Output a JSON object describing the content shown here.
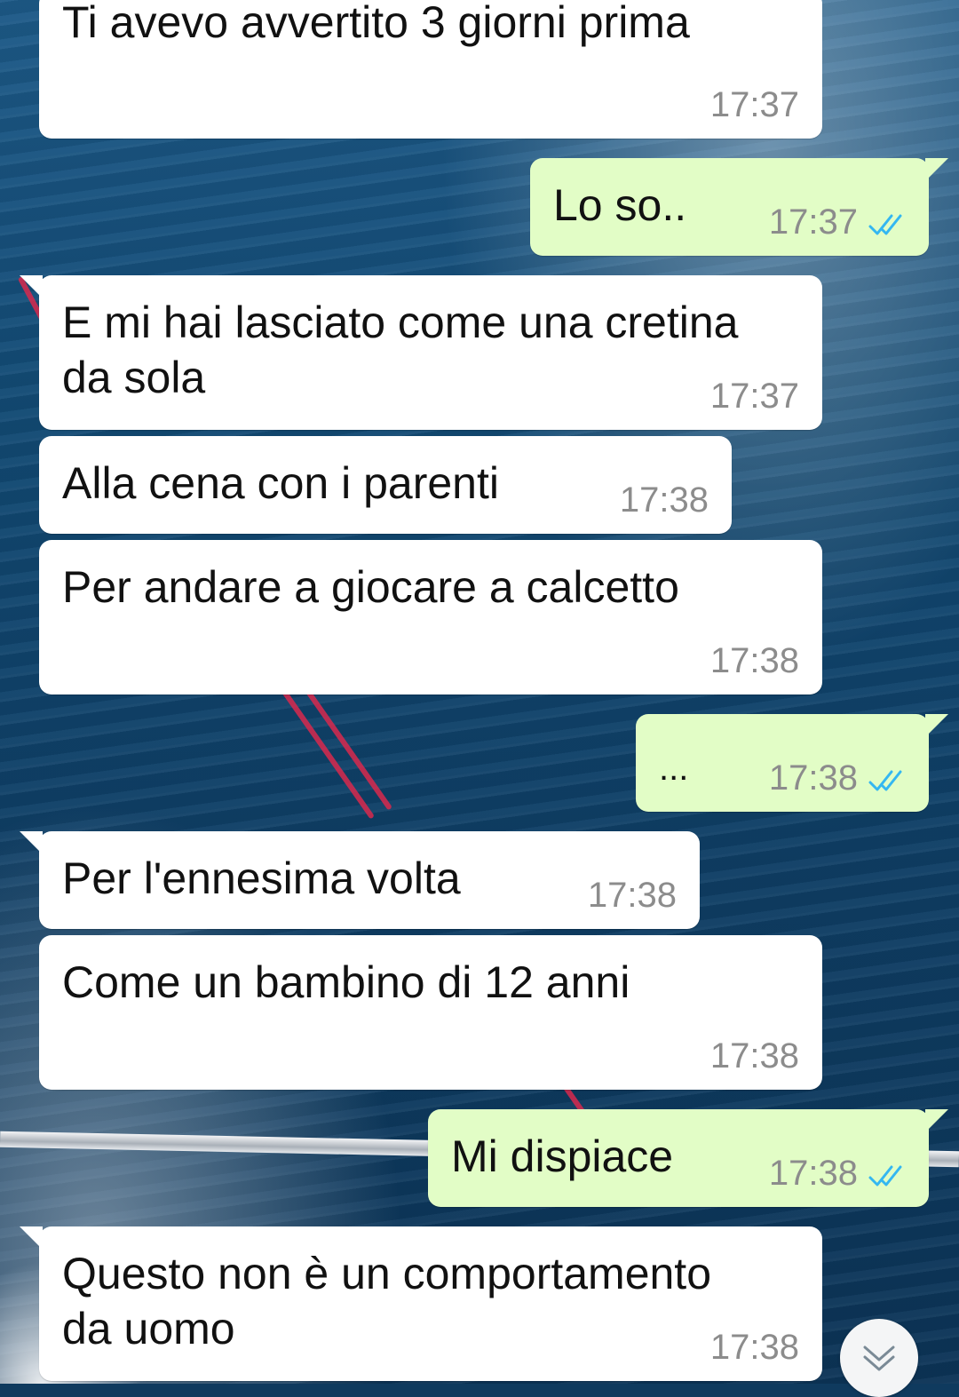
{
  "colors": {
    "incoming_bubble": "#ffffff",
    "outgoing_bubble": "#e2fdc6",
    "timestamp": "#8c8c8c",
    "read_ticks": "#34b7f1"
  },
  "messages": [
    {
      "direction": "incoming",
      "text": "Ti avevo avvertito 3 giorni prima",
      "time": "17:37"
    },
    {
      "direction": "outgoing",
      "text": "Lo so..",
      "time": "17:37",
      "status": "read"
    },
    {
      "direction": "incoming",
      "text": "E mi hai lasciato come una cretina\nda sola",
      "time": "17:37"
    },
    {
      "direction": "incoming",
      "text": "Alla cena con i parenti",
      "time": "17:38"
    },
    {
      "direction": "incoming",
      "text": "Per andare a giocare a calcetto",
      "time": "17:38"
    },
    {
      "direction": "outgoing",
      "text": "...",
      "time": "17:38",
      "status": "read"
    },
    {
      "direction": "incoming",
      "text": "Per l'ennesima volta",
      "time": "17:38"
    },
    {
      "direction": "incoming",
      "text": "Come un bambino di 12 anni",
      "time": "17:38"
    },
    {
      "direction": "outgoing",
      "text": "Mi dispiace",
      "time": "17:38",
      "status": "read"
    },
    {
      "direction": "incoming",
      "text": "Questo non è un comportamento\nda uomo",
      "time": "17:38"
    }
  ],
  "scroll_down_button": {
    "icon": "double-chevron-down-icon"
  }
}
